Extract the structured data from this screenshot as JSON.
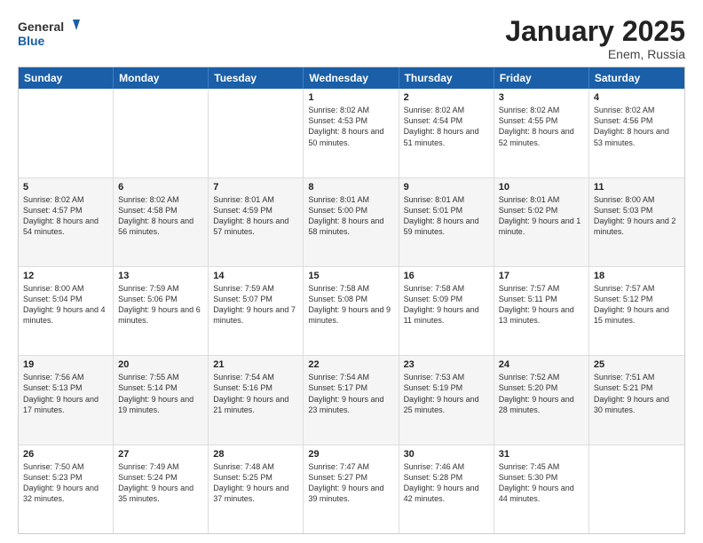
{
  "header": {
    "logo_general": "General",
    "logo_blue": "Blue",
    "month_title": "January 2025",
    "location": "Enem, Russia"
  },
  "weekdays": [
    "Sunday",
    "Monday",
    "Tuesday",
    "Wednesday",
    "Thursday",
    "Friday",
    "Saturday"
  ],
  "rows": [
    [
      {
        "day": "",
        "text": ""
      },
      {
        "day": "",
        "text": ""
      },
      {
        "day": "",
        "text": ""
      },
      {
        "day": "1",
        "text": "Sunrise: 8:02 AM\nSunset: 4:53 PM\nDaylight: 8 hours\nand 50 minutes."
      },
      {
        "day": "2",
        "text": "Sunrise: 8:02 AM\nSunset: 4:54 PM\nDaylight: 8 hours\nand 51 minutes."
      },
      {
        "day": "3",
        "text": "Sunrise: 8:02 AM\nSunset: 4:55 PM\nDaylight: 8 hours\nand 52 minutes."
      },
      {
        "day": "4",
        "text": "Sunrise: 8:02 AM\nSunset: 4:56 PM\nDaylight: 8 hours\nand 53 minutes."
      }
    ],
    [
      {
        "day": "5",
        "text": "Sunrise: 8:02 AM\nSunset: 4:57 PM\nDaylight: 8 hours\nand 54 minutes."
      },
      {
        "day": "6",
        "text": "Sunrise: 8:02 AM\nSunset: 4:58 PM\nDaylight: 8 hours\nand 56 minutes."
      },
      {
        "day": "7",
        "text": "Sunrise: 8:01 AM\nSunset: 4:59 PM\nDaylight: 8 hours\nand 57 minutes."
      },
      {
        "day": "8",
        "text": "Sunrise: 8:01 AM\nSunset: 5:00 PM\nDaylight: 8 hours\nand 58 minutes."
      },
      {
        "day": "9",
        "text": "Sunrise: 8:01 AM\nSunset: 5:01 PM\nDaylight: 8 hours\nand 59 minutes."
      },
      {
        "day": "10",
        "text": "Sunrise: 8:01 AM\nSunset: 5:02 PM\nDaylight: 9 hours\nand 1 minute."
      },
      {
        "day": "11",
        "text": "Sunrise: 8:00 AM\nSunset: 5:03 PM\nDaylight: 9 hours\nand 2 minutes."
      }
    ],
    [
      {
        "day": "12",
        "text": "Sunrise: 8:00 AM\nSunset: 5:04 PM\nDaylight: 9 hours\nand 4 minutes."
      },
      {
        "day": "13",
        "text": "Sunrise: 7:59 AM\nSunset: 5:06 PM\nDaylight: 9 hours\nand 6 minutes."
      },
      {
        "day": "14",
        "text": "Sunrise: 7:59 AM\nSunset: 5:07 PM\nDaylight: 9 hours\nand 7 minutes."
      },
      {
        "day": "15",
        "text": "Sunrise: 7:58 AM\nSunset: 5:08 PM\nDaylight: 9 hours\nand 9 minutes."
      },
      {
        "day": "16",
        "text": "Sunrise: 7:58 AM\nSunset: 5:09 PM\nDaylight: 9 hours\nand 11 minutes."
      },
      {
        "day": "17",
        "text": "Sunrise: 7:57 AM\nSunset: 5:11 PM\nDaylight: 9 hours\nand 13 minutes."
      },
      {
        "day": "18",
        "text": "Sunrise: 7:57 AM\nSunset: 5:12 PM\nDaylight: 9 hours\nand 15 minutes."
      }
    ],
    [
      {
        "day": "19",
        "text": "Sunrise: 7:56 AM\nSunset: 5:13 PM\nDaylight: 9 hours\nand 17 minutes."
      },
      {
        "day": "20",
        "text": "Sunrise: 7:55 AM\nSunset: 5:14 PM\nDaylight: 9 hours\nand 19 minutes."
      },
      {
        "day": "21",
        "text": "Sunrise: 7:54 AM\nSunset: 5:16 PM\nDaylight: 9 hours\nand 21 minutes."
      },
      {
        "day": "22",
        "text": "Sunrise: 7:54 AM\nSunset: 5:17 PM\nDaylight: 9 hours\nand 23 minutes."
      },
      {
        "day": "23",
        "text": "Sunrise: 7:53 AM\nSunset: 5:19 PM\nDaylight: 9 hours\nand 25 minutes."
      },
      {
        "day": "24",
        "text": "Sunrise: 7:52 AM\nSunset: 5:20 PM\nDaylight: 9 hours\nand 28 minutes."
      },
      {
        "day": "25",
        "text": "Sunrise: 7:51 AM\nSunset: 5:21 PM\nDaylight: 9 hours\nand 30 minutes."
      }
    ],
    [
      {
        "day": "26",
        "text": "Sunrise: 7:50 AM\nSunset: 5:23 PM\nDaylight: 9 hours\nand 32 minutes."
      },
      {
        "day": "27",
        "text": "Sunrise: 7:49 AM\nSunset: 5:24 PM\nDaylight: 9 hours\nand 35 minutes."
      },
      {
        "day": "28",
        "text": "Sunrise: 7:48 AM\nSunset: 5:25 PM\nDaylight: 9 hours\nand 37 minutes."
      },
      {
        "day": "29",
        "text": "Sunrise: 7:47 AM\nSunset: 5:27 PM\nDaylight: 9 hours\nand 39 minutes."
      },
      {
        "day": "30",
        "text": "Sunrise: 7:46 AM\nSunset: 5:28 PM\nDaylight: 9 hours\nand 42 minutes."
      },
      {
        "day": "31",
        "text": "Sunrise: 7:45 AM\nSunset: 5:30 PM\nDaylight: 9 hours\nand 44 minutes."
      },
      {
        "day": "",
        "text": ""
      }
    ]
  ]
}
